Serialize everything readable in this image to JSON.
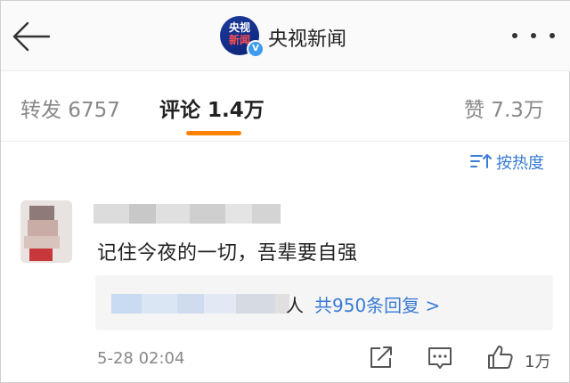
{
  "header": {
    "logo_line1": "央视",
    "logo_line2": "新闻",
    "verified_mark": "V",
    "title": "央视新闻"
  },
  "tabs": {
    "repost": "转发 6757",
    "comments": "评论 1.4万",
    "likes": "赞 7.3万"
  },
  "sort": {
    "label": "按热度"
  },
  "comment": {
    "text": "记住今夜的一切，吾辈要自强",
    "reply_person_suffix": "人",
    "reply_count": "共950条回复 >",
    "timestamp": "5-28 02:04",
    "like_count": "1万"
  },
  "colors": {
    "accent_orange": "#ff8200",
    "link_blue": "#3a7bd5",
    "text_primary": "#222222",
    "text_secondary": "#888888",
    "reply_bg": "#f5f5f5"
  },
  "icons": [
    "back-arrow-icon",
    "more-dots-icon",
    "verified-badge-icon",
    "sort-icon",
    "share-icon",
    "comment-icon",
    "like-icon"
  ]
}
